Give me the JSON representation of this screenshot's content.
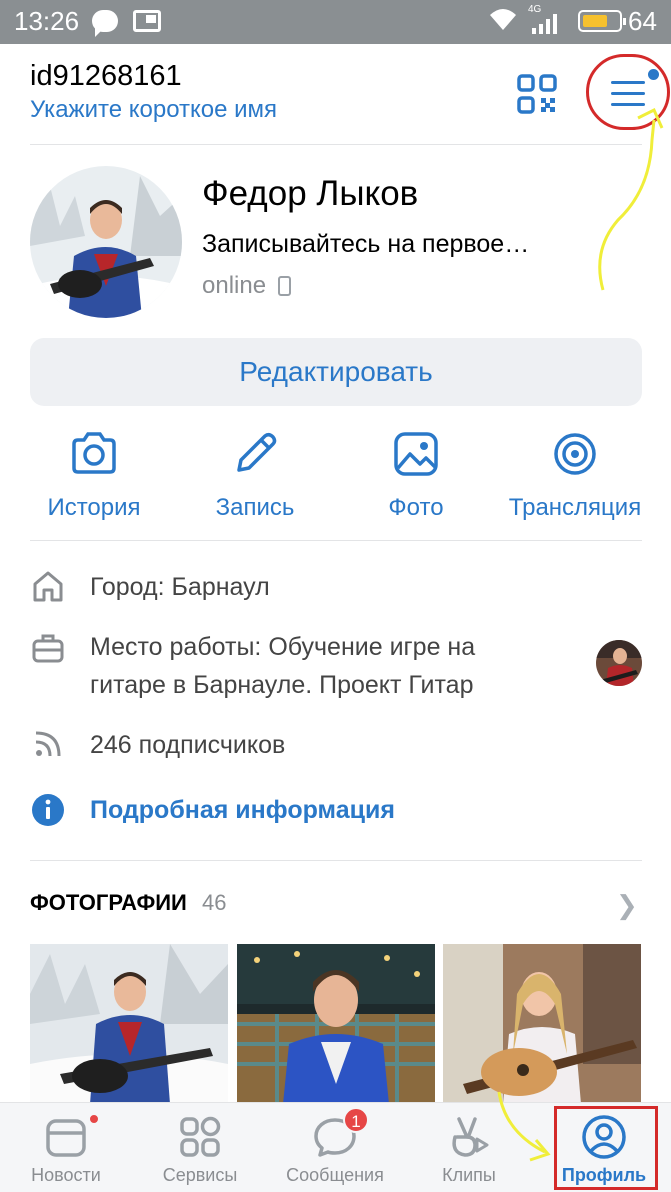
{
  "status_bar": {
    "time": "13:26",
    "battery_percent": "64"
  },
  "header": {
    "user_id": "id91268161",
    "short_name_link": "Укажите короткое имя"
  },
  "profile": {
    "name": "Федор Лыков",
    "status": "Записывайтесь на первое…",
    "presence": "online",
    "edit_button": "Редактировать"
  },
  "actions": [
    {
      "label": "История",
      "icon": "camera-icon"
    },
    {
      "label": "Запись",
      "icon": "pencil-icon"
    },
    {
      "label": "Фото",
      "icon": "image-icon"
    },
    {
      "label": "Трансляция",
      "icon": "broadcast-icon"
    }
  ],
  "info": {
    "city": "Город: Барнаул",
    "work_line1": "Место работы: Обучение игре на",
    "work_line2": "гитаре в Барнауле. Проект Гитар",
    "followers": "246 подписчиков",
    "details_link": "Подробная информация"
  },
  "photos": {
    "title": "ФОТОГРАФИИ",
    "count": "46"
  },
  "tabs": [
    {
      "label": "Новости",
      "icon": "news-icon",
      "badge_dot": true
    },
    {
      "label": "Сервисы",
      "icon": "services-icon"
    },
    {
      "label": "Сообщения",
      "icon": "messages-icon",
      "badge": "1"
    },
    {
      "label": "Клипы",
      "icon": "clips-icon"
    },
    {
      "label": "Профиль",
      "icon": "profile-icon",
      "active": true
    }
  ],
  "colors": {
    "accent": "#2a78c8",
    "annotation_red": "#d42a2a",
    "annotation_yellow": "#f0ee3a",
    "badge_red": "#e64646"
  }
}
